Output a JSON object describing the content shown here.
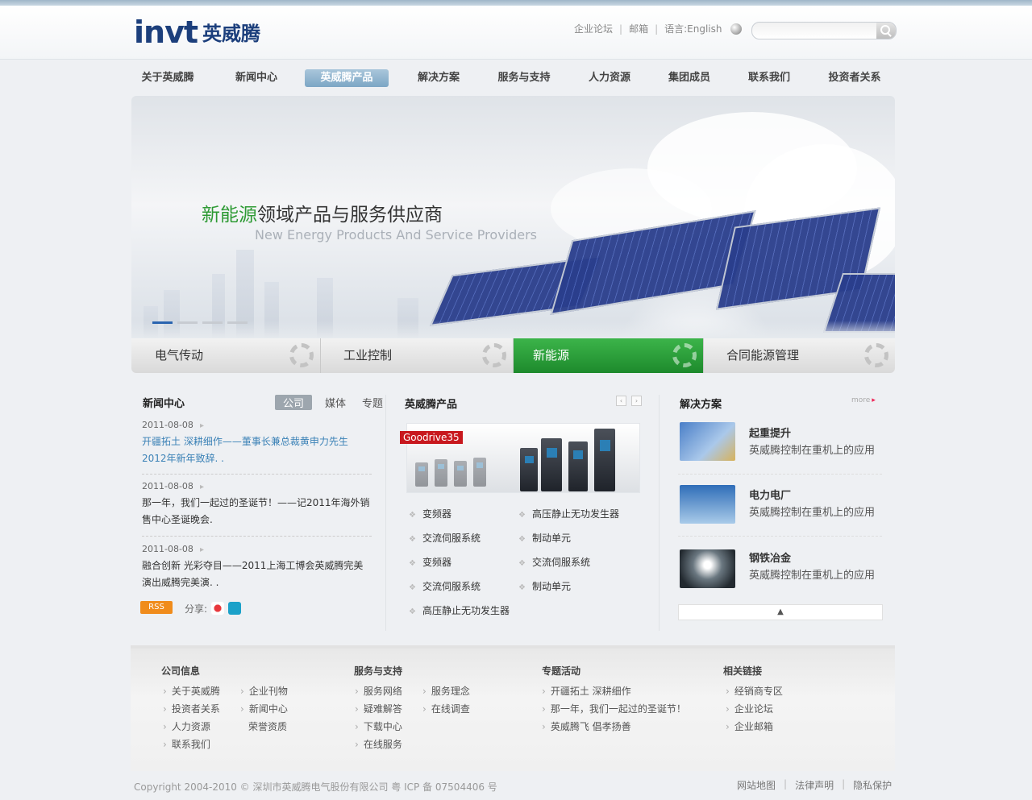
{
  "header": {
    "logo_en": "invt",
    "logo_cn": "英威腾",
    "links": [
      "企业论坛",
      "邮箱"
    ],
    "language_label": "语言:English",
    "search_placeholder": ""
  },
  "nav": {
    "items": [
      "关于英威腾",
      "新闻中心",
      "英威腾产品",
      "解决方案",
      "服务与支持",
      "人力资源",
      "集团成员",
      "联系我们",
      "投资者关系"
    ],
    "active": "英威腾产品"
  },
  "banner": {
    "title_green": "新能源",
    "title_rest": "领域产品与服务供应商",
    "subtitle": "New Energy Products And Service Providers",
    "slides": 4,
    "active_slide": 1
  },
  "categories": {
    "items": [
      "电气传动",
      "工业控制",
      "新能源",
      "合同能源管理"
    ],
    "active": "新能源"
  },
  "news": {
    "title": "新闻中心",
    "tabs": [
      "公司",
      "媒体",
      "专题"
    ],
    "active_tab": "公司",
    "items": [
      {
        "date": "2011-08-08",
        "text": "开疆拓土 深耕细作——董事长兼总裁黄申力先生2012年新年致辞. ."
      },
      {
        "date": "2011-08-08",
        "text": "那一年，我们一起过的圣诞节！——记2011年海外销售中心圣诞晚会."
      },
      {
        "date": "2011-08-08",
        "text": "融合创新 光彩夺目——2011上海工博会英威腾完美演出威腾完美演. ."
      }
    ],
    "rss": "RSS",
    "share": "分享:"
  },
  "products": {
    "title": "英威腾产品",
    "tag": "Goodrive35",
    "list": [
      "变频器",
      "高压静止无功发生器",
      "交流伺服系统",
      "制动单元",
      "变频器",
      "交流伺服系统",
      "交流伺服系统",
      "制动单元",
      "高压静止无功发生器"
    ]
  },
  "solutions": {
    "title": "解决方案",
    "more": "more",
    "items": [
      {
        "title": "起重提升",
        "desc": "英威腾控制在重机上的应用"
      },
      {
        "title": "电力电厂",
        "desc": "英威腾控制在重机上的应用"
      },
      {
        "title": "钢铁冶金",
        "desc": "英威腾控制在重机上的应用"
      }
    ],
    "toggle": "▲"
  },
  "footer": {
    "groups": [
      {
        "title": "公司信息",
        "links": [
          "关于英威腾",
          "投资者关系",
          "人力资源",
          "联系我们",
          "企业刊物",
          "新闻中心",
          "荣誉资质"
        ]
      },
      {
        "title": "服务与支持",
        "links": [
          "服务网络",
          "疑难解答",
          "下载中心",
          "在线服务",
          "服务理念",
          "在线调查"
        ]
      },
      {
        "title": "专题活动",
        "links": [
          "开疆拓土 深耕细作",
          "那一年，我们一起过的圣诞节！",
          "英威腾飞 倡孝扬善"
        ]
      },
      {
        "title": "相关链接",
        "links": [
          "经销商专区",
          "企业论坛",
          "企业邮箱"
        ]
      }
    ],
    "copyright": "Copyright 2004-2010 © 深圳市英威腾电气股份有限公司 粤 ICP 备 07504406 号",
    "bottom_links": [
      "网站地图",
      "法律声明",
      "隐私保护"
    ]
  },
  "colors": {
    "brand": "#1c3f7c",
    "accent_green": "#2e9a34",
    "nav_active": "#7ca6c5",
    "news_blue": "#3a81b6"
  }
}
